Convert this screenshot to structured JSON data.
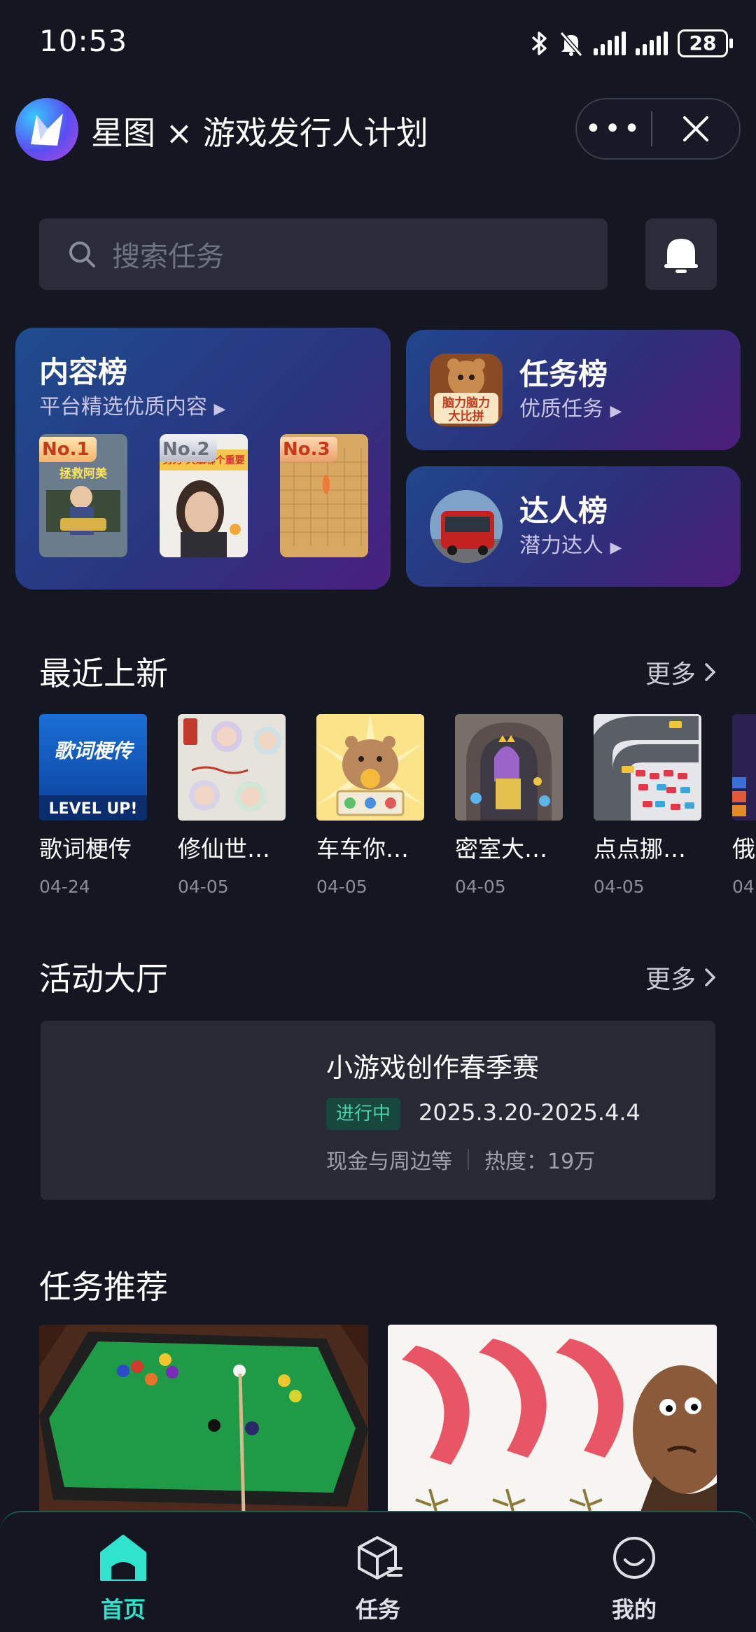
{
  "status_bar": {
    "time": "10:53",
    "battery": "28",
    "icons": [
      "bluetooth-icon",
      "mute-icon",
      "signal-icon",
      "signal-icon",
      "battery-icon"
    ]
  },
  "header": {
    "title": "星图 × 游戏发行人计划",
    "more_label": "•••"
  },
  "search": {
    "placeholder": "搜索任务"
  },
  "rankings": {
    "content": {
      "title": "内容榜",
      "subtitle": "平台精选优质内容",
      "badges": [
        "No.1",
        "No.2",
        "No.3"
      ]
    },
    "task": {
      "title": "任务榜",
      "subtitle": "优质任务",
      "icon_text": "脑力脑力大比拼"
    },
    "talent": {
      "title": "达人榜",
      "subtitle": "潜力达人"
    }
  },
  "recent": {
    "title": "最近上新",
    "more_label": "更多",
    "items": [
      {
        "name": "歌词梗传",
        "date": "04-24",
        "cover_text": "歌词梗传",
        "cover_sub": "LEVEL UP!"
      },
      {
        "name": "修仙世…",
        "date": "04-05"
      },
      {
        "name": "车车你…",
        "date": "04-05"
      },
      {
        "name": "密室大…",
        "date": "04-05"
      },
      {
        "name": "点点挪…",
        "date": "04-05"
      },
      {
        "name": "俄",
        "date": "04"
      }
    ]
  },
  "activity": {
    "title": "活动大厅",
    "more_label": "更多",
    "card": {
      "name": "小游戏创作春季赛",
      "status": "进行中",
      "period": "2025.3.20-2025.4.4",
      "reward": "现金与周边等",
      "heat": "热度：19万"
    }
  },
  "task_recommend": {
    "title": "任务推荐"
  },
  "tabbar": {
    "items": [
      {
        "label": "首页",
        "icon": "home-icon",
        "active": true
      },
      {
        "label": "任务",
        "icon": "task-box-icon",
        "active": false
      },
      {
        "label": "我的",
        "icon": "profile-icon",
        "active": false
      }
    ]
  },
  "colors": {
    "background": "#141622",
    "accent": "#2fe3cc",
    "status_green": "#46d6ac"
  }
}
